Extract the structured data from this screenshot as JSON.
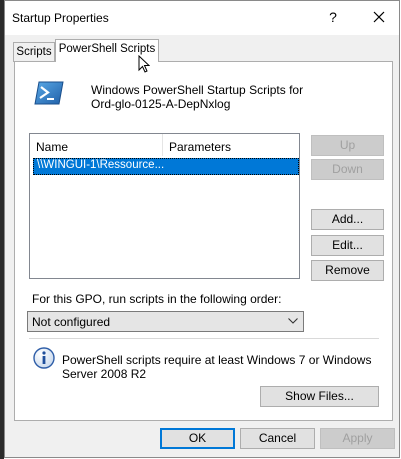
{
  "window": {
    "title": "Startup Properties",
    "help_label": "?"
  },
  "tabs": [
    {
      "label": "Scripts"
    },
    {
      "label": "PowerShell Scripts"
    }
  ],
  "header": {
    "line1": "Windows PowerShell Startup Scripts for",
    "line2": "Ord-glo-0125-A-DepNxlog"
  },
  "list": {
    "columns": [
      "Name",
      "Parameters"
    ],
    "rows": [
      {
        "name": "\\\\WINGUI-1\\Ressource...",
        "parameters": ""
      }
    ]
  },
  "side_buttons": {
    "up": "Up",
    "down": "Down",
    "add": "Add...",
    "edit": "Edit...",
    "remove": "Remove"
  },
  "order": {
    "label": "For this GPO, run scripts in the following order:",
    "selected": "Not configured"
  },
  "info": {
    "text": "PowerShell scripts require at least Windows 7 or Windows Server 2008 R2"
  },
  "show_files": "Show Files...",
  "footer": {
    "ok": "OK",
    "cancel": "Cancel",
    "apply": "Apply"
  },
  "colors": {
    "selection": "#0078d7",
    "dialog_bg": "#f0f0f0",
    "default_button_border": "#0078d7"
  },
  "icons": [
    "powershell-icon",
    "info-icon",
    "close-icon",
    "chevron-down-icon",
    "mouse-pointer-icon"
  ]
}
